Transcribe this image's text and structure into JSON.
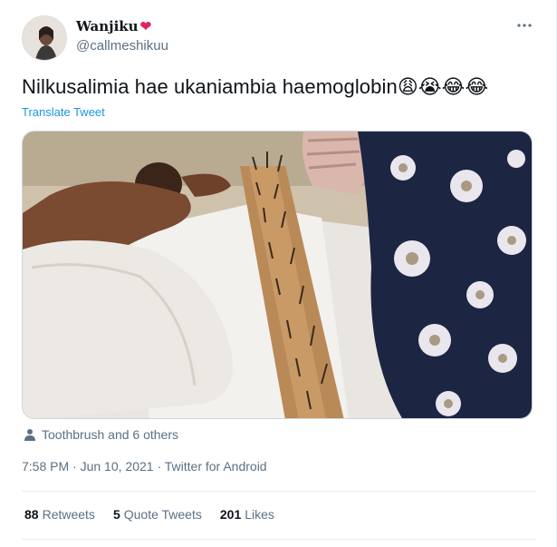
{
  "user": {
    "display_name": "Wanjiku",
    "name_emoji": "❤",
    "handle": "@callmeshikuu"
  },
  "tweet": {
    "text": "Nilkusalimia hae ukaniambia haemoglobin",
    "emojis": "😩😭😂😂",
    "translate_label": "Translate Tweet"
  },
  "media": {
    "description_icon": "photo"
  },
  "tagged": {
    "icon": "person-icon",
    "text": "Toothbrush and 6 others"
  },
  "meta": {
    "time": "7:58 PM",
    "date": "Jun 10, 2021",
    "source": "Twitter for Android"
  },
  "stats": {
    "retweets_count": "88",
    "retweets_label": "Retweets",
    "quotes_count": "5",
    "quotes_label": "Quote Tweets",
    "likes_count": "201",
    "likes_label": "Likes"
  },
  "colors": {
    "link": "#1b95e0",
    "muted": "#5b7083",
    "heart": "#e0245e"
  }
}
